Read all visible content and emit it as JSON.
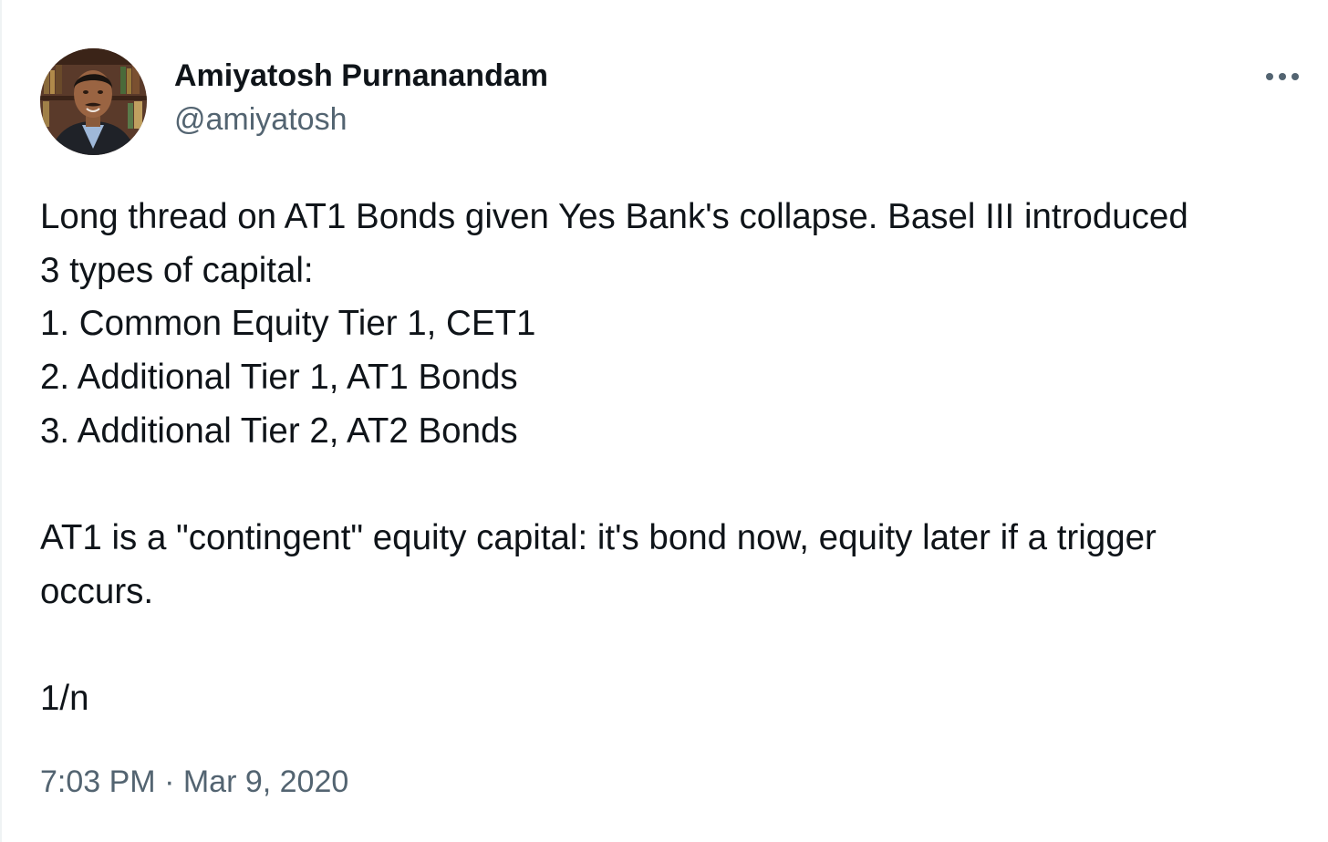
{
  "author": {
    "display_name": "Amiyatosh Purnanandam",
    "handle": "@amiyatosh",
    "avatar_icon": "profile-photo"
  },
  "menu": {
    "more_icon": "more-horizontal-icon"
  },
  "tweet": {
    "lines": [
      "Long thread on AT1 Bonds given Yes Bank's collapse. Basel III introduced",
      "3 types of capital:",
      "1. Common Equity Tier 1, CET1",
      "2. Additional Tier 1, AT1 Bonds",
      "3. Additional Tier 2, AT2 Bonds",
      "",
      "AT1 is a \"contingent\" equity capital: it's bond now, equity later if a trigger",
      "occurs.",
      "",
      "1/n"
    ],
    "timestamp": "7:03 PM · Mar 9, 2020"
  },
  "colors": {
    "text_primary": "#0f1419",
    "text_secondary": "#536471",
    "border": "#eff3f4",
    "background": "#ffffff"
  }
}
